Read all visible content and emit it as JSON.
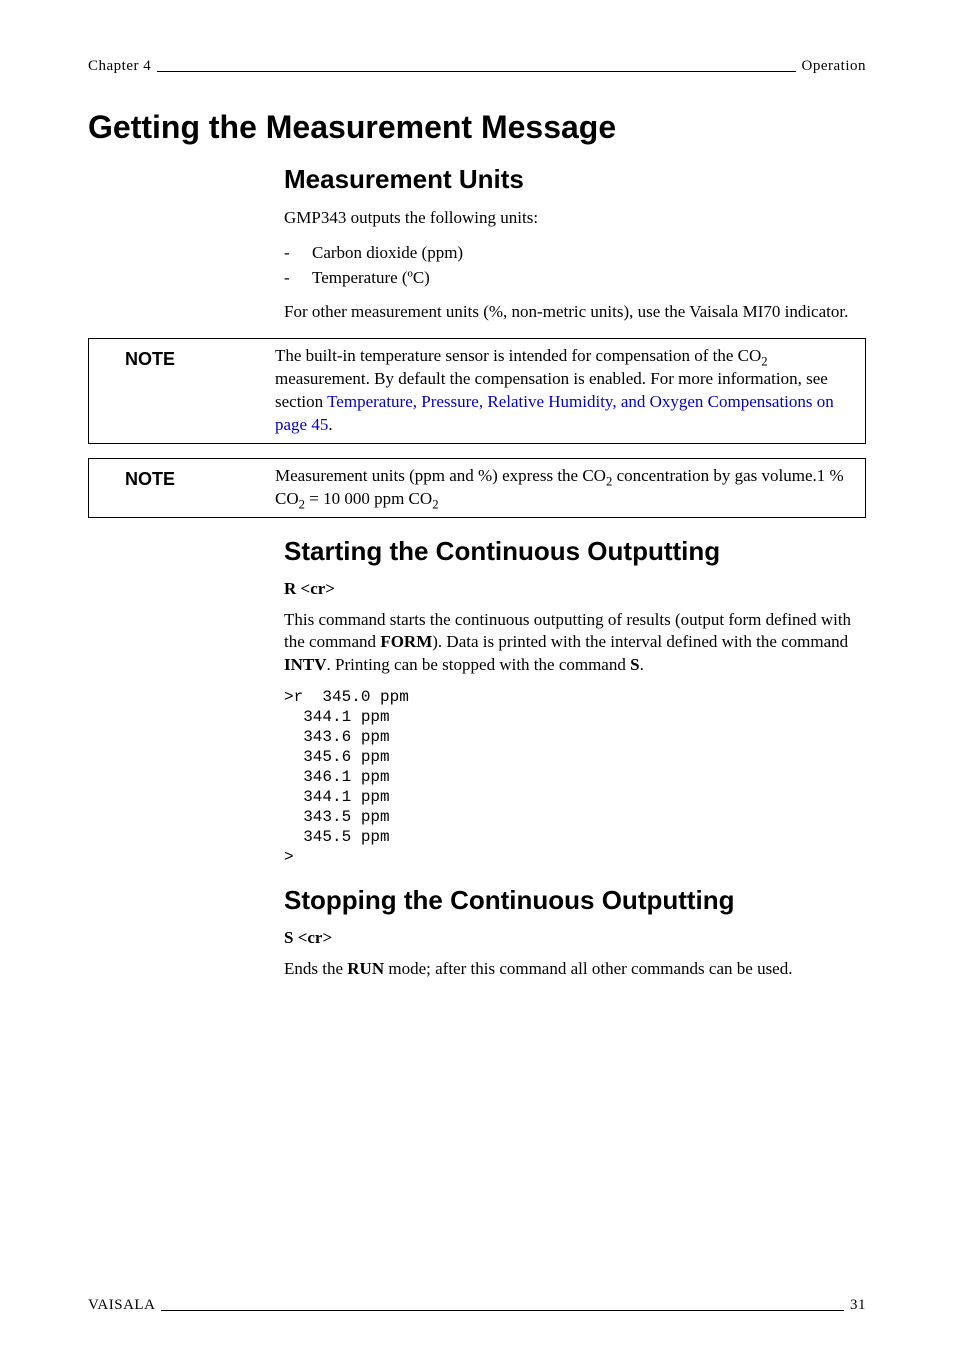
{
  "header": {
    "left": "Chapter 4",
    "right": "Operation"
  },
  "h1": "Getting the Measurement Message",
  "section_units": {
    "title": "Measurement Units",
    "intro": "GMP343 outputs the following units:",
    "items": [
      "Carbon dioxide (ppm)",
      "Temperature (ºC)"
    ],
    "after": "For other measurement units (%, non-metric units), use the Vaisala MI70 indicator."
  },
  "note1": {
    "label": "NOTE",
    "pre": "The built-in temperature sensor is intended for compensation of the CO",
    "sub1": "2",
    "mid": " measurement. By default the compensation is enabled. For more information, see section ",
    "link": "Temperature, Pressure, Relative Humidity, and Oxygen Compensations on page 45",
    "post": "."
  },
  "note2": {
    "label": "NOTE",
    "pre": "Measurement units (ppm and %) express the CO",
    "sub1": "2",
    "line1_tail": " concentration by gas",
    "line2_pre": "volume.1 % CO",
    "sub2": "2",
    "line2_mid": " = 10 000 ppm CO",
    "sub3": "2"
  },
  "section_start": {
    "title": "Starting the Continuous Outputting",
    "cmd": "R <cr>",
    "body_parts": {
      "p1": "This command starts the continuous outputting of results (output form defined with the command ",
      "b1": "FORM",
      "p2": "). Data is printed with the interval defined with the command ",
      "b2": "INTV",
      "p3": ". Printing can be stopped with the command ",
      "b3": "S",
      "p4": "."
    },
    "mono": ">r  345.0 ppm\n  344.1 ppm\n  343.6 ppm\n  345.6 ppm\n  346.1 ppm\n  344.1 ppm\n  343.5 ppm\n  345.5 ppm\n>"
  },
  "section_stop": {
    "title": "Stopping the Continuous Outputting",
    "cmd": "S <cr>",
    "body_parts": {
      "p1": "Ends the ",
      "b1": "RUN",
      "p2": " mode; after this command all other commands can be used."
    }
  },
  "footer": {
    "left": "VAISALA",
    "right": "31"
  }
}
